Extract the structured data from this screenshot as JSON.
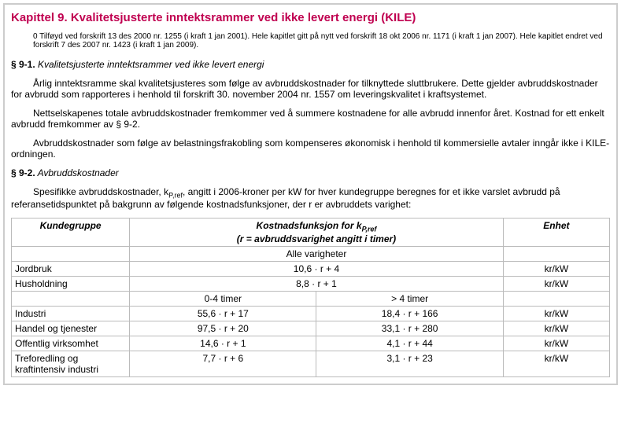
{
  "chapter_title": "Kapittel 9. Kvalitetsjusterte inntektsrammer ved ikke levert energi (KILE)",
  "note0": "0 Tilføyd ved forskrift 13 des 2000 nr. 1255 (i kraft 1 jan 2001). Hele kapitlet gitt på nytt ved forskrift 18 okt 2006 nr. 1171 (i kraft 1 jan 2007). Hele kapitlet endret ved forskrift 7 des 2007 nr. 1423 (i kraft 1 jan 2009).",
  "sec91": {
    "num": "§ 9-1.",
    "title": " Kvalitetsjusterte inntektsrammer ved ikke levert energi",
    "p1": "Årlig inntektsramme skal kvalitetsjusteres som følge av avbruddskostnader for tilknyttede sluttbrukere. Dette gjelder avbruddskostnader for avbrudd som rapporteres i henhold til forskrift 30. november 2004 nr. 1557 om leveringskvalitet i kraftsystemet.",
    "p2": "Nettselskapenes totale avbruddskostnader fremkommer ved å summere kostnadene for alle avbrudd innenfor året. Kostnad for ett enkelt avbrudd fremkommer av § 9-2.",
    "p3": "Avbruddskostnader som følge av belastningsfrakobling som kompenseres økonomisk i henhold til kommersielle avtaler inngår ikke i KILE-ordningen."
  },
  "sec92": {
    "num": "§ 9-2.",
    "title": " Avbruddskostnader",
    "intro_a": "Spesifikke avbruddskostnader, k",
    "intro_sub": "P,ref",
    "intro_b": ", angitt i 2006-kroner per kW for hver kundegruppe beregnes for et ikke varslet avbrudd på referansetidspunktet på bakgrunn av følgende kostnadsfunksjoner, der r er avbruddets varighet:"
  },
  "table": {
    "h1": "Kundegruppe",
    "h2a": "Kostnadsfunksjon for k",
    "h2sub": "P,ref",
    "h2b": "(r = avbruddsvarighet angitt i timer)",
    "h3": "Enhet",
    "alle": "Alle varigheter",
    "rng1": "0-4 timer",
    "rng2": "> 4 timer",
    "rows_single": [
      {
        "label": "Jordbruk",
        "f": "10,6 · r + 4",
        "unit": "kr/kW"
      },
      {
        "label": "Husholdning",
        "f": "8,8 · r + 1",
        "unit": "kr/kW"
      }
    ],
    "rows_double": [
      {
        "label": "Industri",
        "f1": "55,6 · r + 17",
        "f2": "18,4 · r + 166",
        "unit": "kr/kW"
      },
      {
        "label": "Handel og tjenester",
        "f1": "97,5 · r + 20",
        "f2": "33,1 · r + 280",
        "unit": "kr/kW"
      },
      {
        "label": "Offentlig virksomhet",
        "f1": "14,6 · r + 1",
        "f2": "4,1 · r + 44",
        "unit": "kr/kW"
      },
      {
        "label": "Treforedling og kraftintensiv industri",
        "f1": "7,7 · r + 6",
        "f2": "3,1 · r + 23",
        "unit": "kr/kW"
      }
    ]
  }
}
